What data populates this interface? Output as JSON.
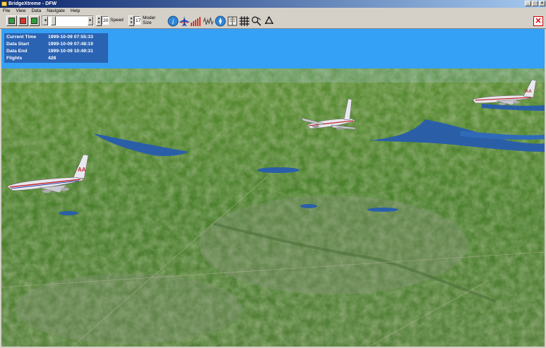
{
  "window": {
    "title": "BridgeXtreme - DFW",
    "minimize": "_",
    "maximize": "□",
    "close": "×"
  },
  "menu": [
    "File",
    "View",
    "Data",
    "Navigate",
    "Help"
  ],
  "toolbar": {
    "speed_value": "20",
    "speed_label": "Speed",
    "model_size_value": "17",
    "model_size_label_1": "Model",
    "model_size_label_2": "Size",
    "close_label": "✕",
    "icons": [
      "info-icon",
      "airplane-icon",
      "bar-chart-icon",
      "waveform-icon",
      "compass-icon",
      "book-icon",
      "grid-icon",
      "search-refresh-icon",
      "recycle-icon"
    ]
  },
  "info_panel": {
    "rows": [
      {
        "label": "Current Time",
        "value": "1999-10-09 07:55:33"
      },
      {
        "label": "Data Start",
        "value": "1999-10-09 07:48:19"
      },
      {
        "label": "Data End",
        "value": "1999-10-09 10:49:31"
      },
      {
        "label": "Flights",
        "value": "428"
      }
    ]
  },
  "colors": {
    "sky": "#34a0f6",
    "info_panel": "#2b63b3",
    "terrain": "#4a7f2c",
    "water": "#2a5fa8"
  }
}
